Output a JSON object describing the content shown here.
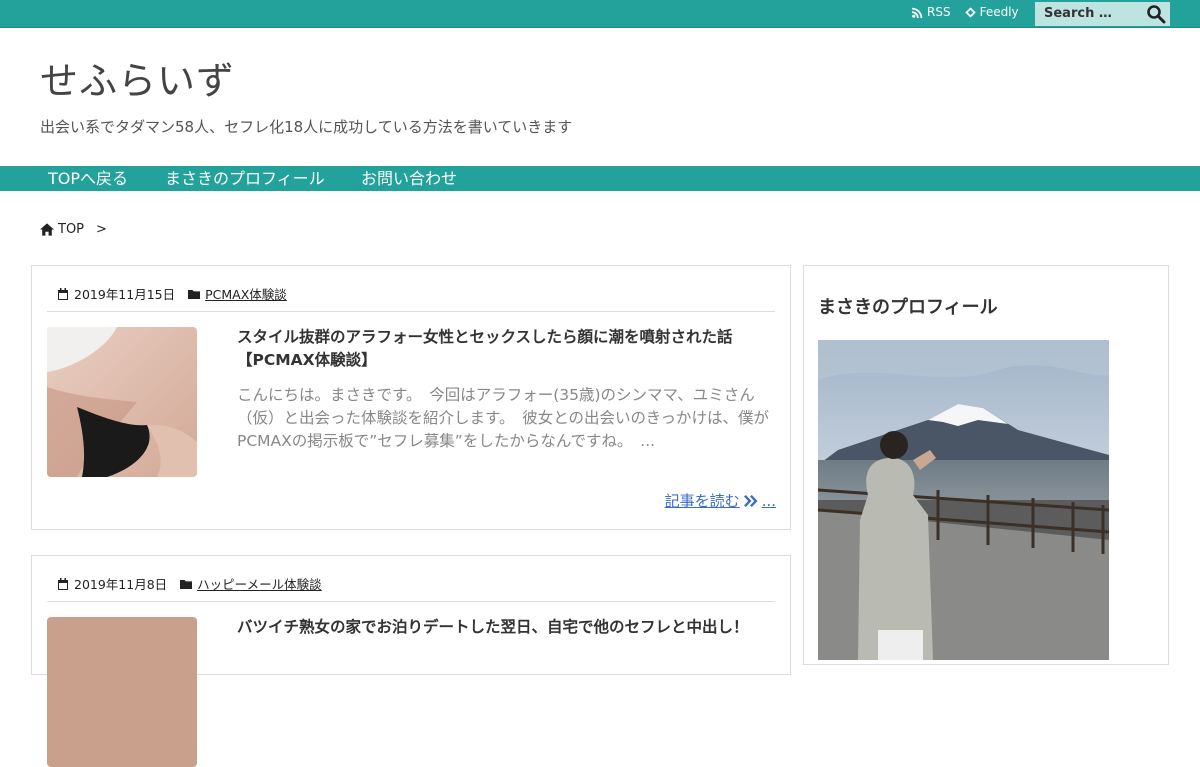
{
  "topbar": {
    "rss_label": "RSS",
    "feedly_label": "Feedly",
    "search_placeholder": "Search …"
  },
  "site": {
    "title": "せふらいず",
    "description": "出会い系でタダマン58人、セフレ化18人に成功している方法を書いていきます"
  },
  "nav": {
    "items": [
      {
        "label": "TOPへ戻る"
      },
      {
        "label": "まさきのプロフィール"
      },
      {
        "label": "お問い合わせ"
      }
    ]
  },
  "breadcrumb": {
    "home_label": "TOP",
    "separator": ">"
  },
  "posts": [
    {
      "date": "2019年11月15日",
      "category": "PCMAX体験談",
      "title": "スタイル抜群のアラフォー女性とセックスしたら顔に潮を噴射された話【PCMAX体験談】",
      "excerpt": "こんにちは。まさきです。　今回はアラフォー(35歳)のシンママ、ユミさん（仮）と出会った体験談を紹介します。　彼女との出会いのきっかけは、僕がPCMAXの掲示板で”セフレ募集”をしたからなんですね。　...",
      "read_more": "記事を読む",
      "read_more_suffix": "..."
    },
    {
      "date": "2019年11月8日",
      "category": "ハッピーメール体験談",
      "title": "バツイチ熟女の家でお泊りデートした翌日、自宅で他のセフレと中出し！"
    }
  ],
  "sidebar": {
    "profile_heading": "まさきのプロフィール"
  },
  "colors": {
    "accent": "#22a29a",
    "link": "#3b6cc8"
  }
}
